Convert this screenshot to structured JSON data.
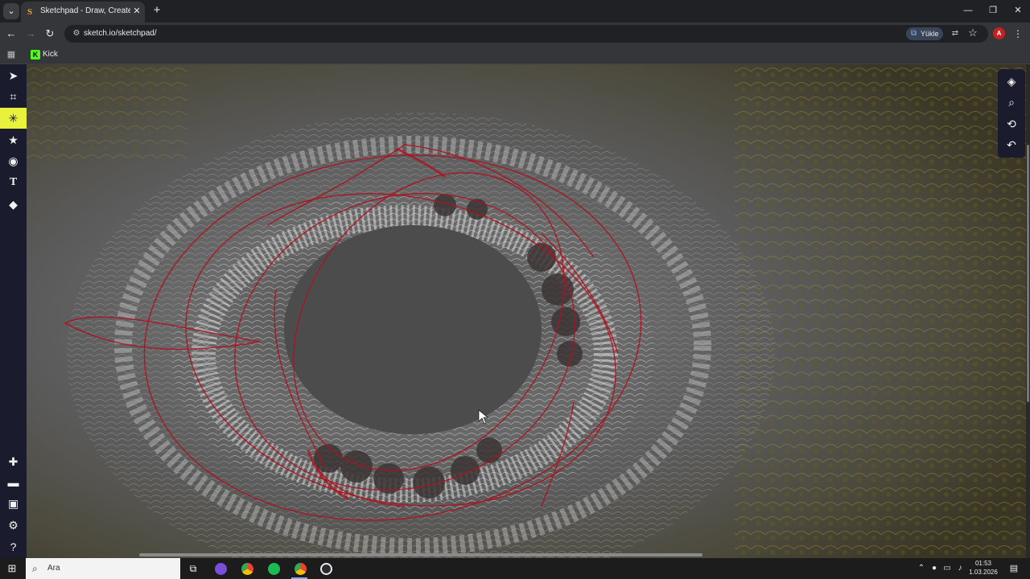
{
  "browser": {
    "tab_search_icon": "chevron-down-icon",
    "active_tab": {
      "title": "Sketchpad - Draw, Create, Share!",
      "favicon": "S",
      "close": "✕"
    },
    "new_tab_label": "+",
    "window_controls": {
      "minimize": "—",
      "restore": "❐",
      "close": "✕"
    },
    "nav": {
      "back": "←",
      "forward": "→",
      "reload": "↻"
    },
    "url": "sketch.io/sketchpad/",
    "install_button_label": "Yükle",
    "profile_initial": "A",
    "bookmarks": [
      {
        "label": "Kick",
        "icon_letter": "K"
      }
    ]
  },
  "app": {
    "left_tools": [
      {
        "name": "select-tool",
        "glyph": "➤",
        "active": false
      },
      {
        "name": "crop-tool",
        "glyph": "⌗",
        "active": false
      },
      {
        "name": "brush-tool",
        "glyph": "✳",
        "active": true
      },
      {
        "name": "stamp-tool",
        "glyph": "★",
        "active": false
      },
      {
        "name": "shape-tool",
        "glyph": "◉",
        "active": false
      },
      {
        "name": "text-tool",
        "glyph": "T",
        "active": false
      },
      {
        "name": "fill-tool",
        "glyph": "◆",
        "active": false
      }
    ],
    "bottom_tools": [
      {
        "name": "new-file",
        "glyph": "✚"
      },
      {
        "name": "open-file",
        "glyph": "▬"
      },
      {
        "name": "save-file",
        "glyph": "▣"
      },
      {
        "name": "settings",
        "glyph": "⚙"
      },
      {
        "name": "help",
        "glyph": "?"
      }
    ],
    "right_tools": [
      {
        "name": "layers",
        "glyph": "◈"
      },
      {
        "name": "zoom",
        "glyph": "⌕"
      },
      {
        "name": "history",
        "glyph": "⟲"
      },
      {
        "name": "undo",
        "glyph": "↶"
      }
    ],
    "accent": "#e8f23c",
    "stroke_color": "#b0101e"
  },
  "taskbar": {
    "search_placeholder": "Ara",
    "time": "01:53",
    "date": "1.03.2026"
  }
}
